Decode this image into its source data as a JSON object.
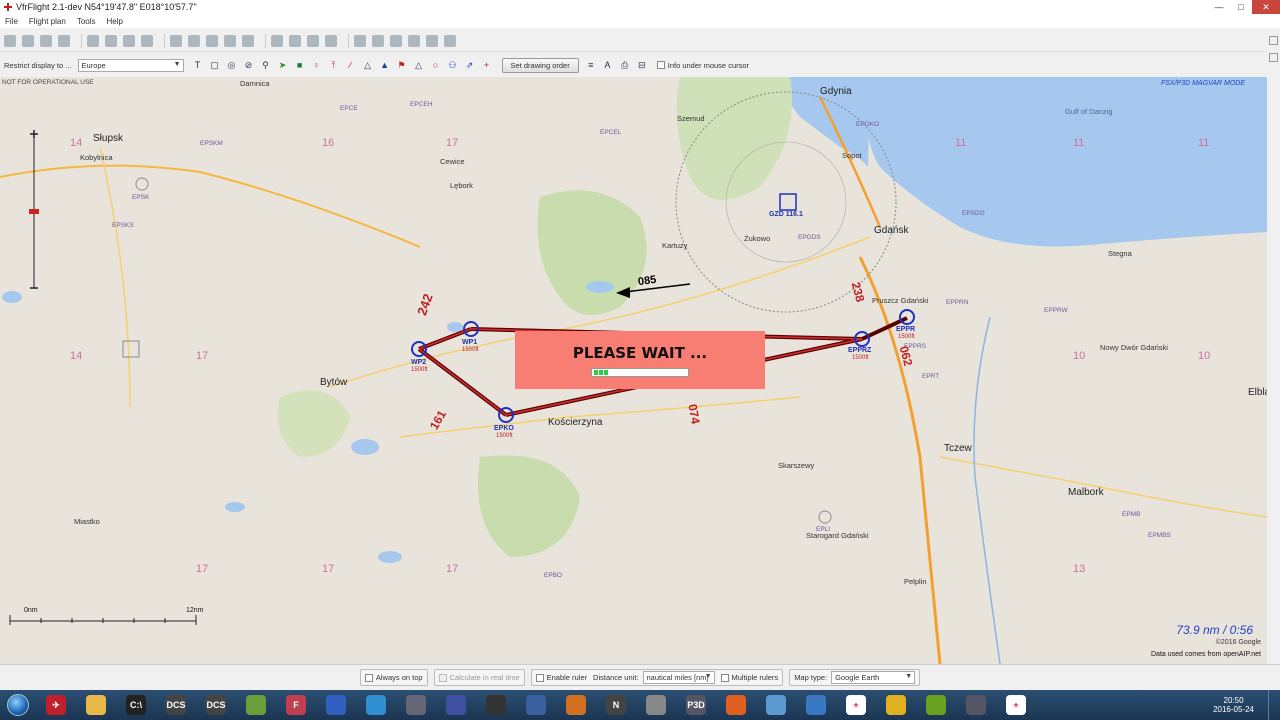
{
  "window": {
    "title": "VfrFlight 2.1-dev    N54°19'47.8\" E018°10'57.7\"",
    "minimize": "—",
    "maximize": "□",
    "close": "✕"
  },
  "menu": [
    "File",
    "Flight plan",
    "Tools",
    "Help"
  ],
  "toolbar2": {
    "restrict_label": "Restrict display to ...",
    "restrict_value": "Europe",
    "set_drawing_order": "Set drawing order",
    "info_under_cursor": "Info under mouse cursor"
  },
  "map": {
    "not_for_operational": "NOT FOR OPERATIONAL USE",
    "magvar": "FSX/P3D MAGVAR MODE",
    "please_wait": "PLEASE WAIT ...",
    "progress": 0.15,
    "distance_readout": "73.9 nm / 0:56",
    "copyright": "©2016 Google",
    "data_source": "Data used comes from openAIP.net",
    "scale_start": "0nm",
    "scale_end": "12nm",
    "cities": [
      {
        "name": "Słupsk",
        "cls": "big"
      },
      {
        "name": "Gdynia",
        "cls": "big"
      },
      {
        "name": "Gdańsk",
        "cls": "big"
      },
      {
        "name": "Bytów",
        "cls": "big"
      },
      {
        "name": "Kartuzy",
        "cls": ""
      },
      {
        "name": "Kościerzyna",
        "cls": "big"
      },
      {
        "name": "Tczew",
        "cls": "big"
      },
      {
        "name": "Malbork",
        "cls": "big"
      },
      {
        "name": "Starogard Gdański",
        "cls": ""
      },
      {
        "name": "Pruszcz Gdański",
        "cls": ""
      },
      {
        "name": "Sopot",
        "cls": ""
      },
      {
        "name": "Lębork",
        "cls": ""
      },
      {
        "name": "Miastko",
        "cls": ""
      },
      {
        "name": "Kobylnica",
        "cls": ""
      },
      {
        "name": "Damnica",
        "cls": ""
      },
      {
        "name": "Cewice",
        "cls": ""
      },
      {
        "name": "Szemud",
        "cls": ""
      },
      {
        "name": "Żukowo",
        "cls": ""
      },
      {
        "name": "Skarszewy",
        "cls": ""
      },
      {
        "name": "Pelplin",
        "cls": ""
      },
      {
        "name": "Elbląg",
        "cls": ""
      },
      {
        "name": "Gulf of Danzig",
        "cls": ""
      },
      {
        "name": "Nowy Dwór Gdański",
        "cls": ""
      },
      {
        "name": "Stegna",
        "cls": ""
      }
    ],
    "waypoints": [
      {
        "id": "WP1",
        "alt": "1500ft"
      },
      {
        "id": "WP2",
        "alt": "1500ft"
      },
      {
        "id": "EPKO",
        "alt": "1500ft"
      },
      {
        "id": "EPPRZ",
        "alt": "1500ft"
      },
      {
        "id": "EPPR",
        "alt": "1500ft"
      },
      {
        "id": "GZD 116.1",
        "alt": ""
      }
    ],
    "leg_labels": [
      "242",
      "085",
      "074",
      "238",
      "062",
      "161"
    ],
    "altitude_grid": [
      "14",
      "16",
      "17",
      "11",
      "10",
      "13"
    ],
    "airspaces": [
      "EPCE",
      "EPCEH",
      "EPSKM",
      "EPCEL",
      "EPOKO",
      "EPSK",
      "EPSKS",
      "EPSDG",
      "EPPRN",
      "EPPRW",
      "EPPRS",
      "EPMB",
      "EPMBS",
      "EPLI",
      "EPBO",
      "EPGDS",
      "EPRT",
      "EPPRG"
    ]
  },
  "status": {
    "always_on_top": "Always on top",
    "calculate_real_time": "Calculate in real time",
    "enable_ruler": "Enable ruler",
    "distance_unit_label": "Distance unit:",
    "distance_unit_value": "nautical miles [nm]",
    "multiple_rulers": "Multiple rulers",
    "map_type_label": "Map type:",
    "map_type_value": "Google Earth"
  },
  "taskbar": {
    "time": "20:50",
    "date": "2016-05-24",
    "apps": [
      {
        "name": "flightsim-app",
        "color": "#c0202a",
        "label": "✈"
      },
      {
        "name": "explorer",
        "color": "#e8b84a",
        "label": ""
      },
      {
        "name": "cmd",
        "color": "#222",
        "label": "C:\\"
      },
      {
        "name": "dcs-1",
        "color": "#444",
        "label": "DCS"
      },
      {
        "name": "dcs-2",
        "color": "#444",
        "label": "DCS"
      },
      {
        "name": "notepad",
        "color": "#6a9e3a",
        "label": ""
      },
      {
        "name": "flag-app",
        "color": "#c04050",
        "label": "F"
      },
      {
        "name": "save-app",
        "color": "#3060c0",
        "label": ""
      },
      {
        "name": "cloud-app",
        "color": "#3090d0",
        "label": ""
      },
      {
        "name": "cube-app",
        "color": "#667",
        "label": ""
      },
      {
        "name": "sim-app",
        "color": "#4050a0",
        "label": ""
      },
      {
        "name": "disc-app",
        "color": "#333",
        "label": ""
      },
      {
        "name": "lock-app",
        "color": "#3a60a0",
        "label": ""
      },
      {
        "name": "gear-app",
        "color": "#d07020",
        "label": ""
      },
      {
        "name": "n-app",
        "color": "#444",
        "label": "N"
      },
      {
        "name": "tools-app",
        "color": "#888",
        "label": ""
      },
      {
        "name": "p3d-app",
        "color": "#556",
        "label": "P3D"
      },
      {
        "name": "firefox",
        "color": "#e06020",
        "label": ""
      },
      {
        "name": "weather-app",
        "color": "#5a9ad0",
        "label": ""
      },
      {
        "name": "mail-app",
        "color": "#3b78c2",
        "label": ""
      },
      {
        "name": "vfr-app",
        "color": "#fff",
        "label": "+"
      },
      {
        "name": "chrome",
        "color": "#e0b020",
        "label": ""
      },
      {
        "name": "nvidia",
        "color": "#6aa020",
        "label": ""
      },
      {
        "name": "stripe-app",
        "color": "#556",
        "label": ""
      },
      {
        "name": "vfr-app-2",
        "color": "#fff",
        "label": "+"
      }
    ]
  }
}
